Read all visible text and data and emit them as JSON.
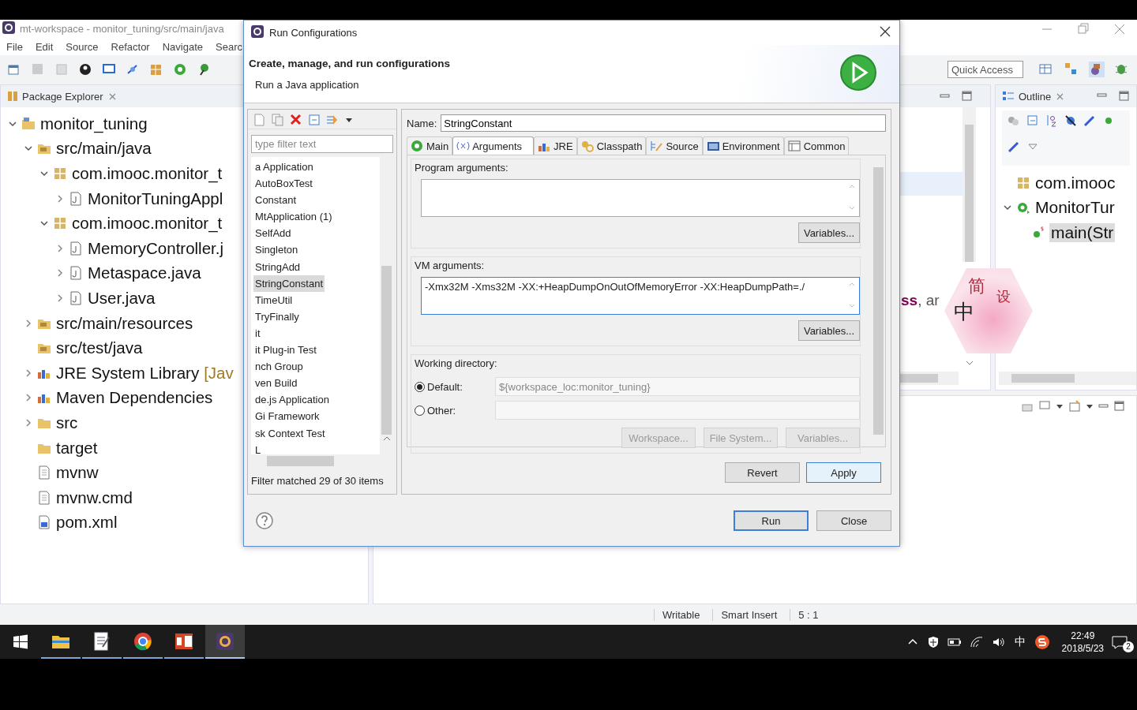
{
  "window": {
    "title": "mt-workspace - monitor_tuning/src/main/java"
  },
  "menu": [
    "File",
    "Edit",
    "Source",
    "Refactor",
    "Navigate",
    "Searc"
  ],
  "quick_access": {
    "placeholder": "Quick Access"
  },
  "package_explorer": {
    "title": "Package Explorer",
    "tree": [
      {
        "label": "monitor_tuning",
        "kind": "project",
        "expanded": true,
        "children": [
          {
            "label": "src/main/java",
            "kind": "source-folder",
            "expanded": true,
            "children": [
              {
                "label": "com.imooc.monitor_t",
                "kind": "package",
                "expanded": true,
                "children": [
                  {
                    "label": "MonitorTuningAppl",
                    "kind": "java-file",
                    "expanded": false
                  }
                ]
              },
              {
                "label": "com.imooc.monitor_t",
                "kind": "package",
                "expanded": true,
                "children": [
                  {
                    "label": "MemoryController.j",
                    "kind": "java-file",
                    "expanded": false
                  },
                  {
                    "label": "Metaspace.java",
                    "kind": "java-file",
                    "expanded": false
                  },
                  {
                    "label": "User.java",
                    "kind": "java-file",
                    "expanded": false
                  }
                ]
              }
            ]
          },
          {
            "label": "src/main/resources",
            "kind": "source-folder",
            "expanded": false
          },
          {
            "label": "src/test/java",
            "kind": "source-folder"
          },
          {
            "label": "JRE System Library",
            "suffix": "[Jav",
            "kind": "library",
            "expanded": false
          },
          {
            "label": "Maven Dependencies",
            "kind": "library",
            "expanded": false
          },
          {
            "label": "src",
            "kind": "folder",
            "expanded": false
          },
          {
            "label": "target",
            "kind": "folder"
          },
          {
            "label": "mvnw",
            "kind": "file"
          },
          {
            "label": "mvnw.cmd",
            "kind": "file"
          },
          {
            "label": "pom.xml",
            "kind": "xml-file"
          }
        ]
      }
    ]
  },
  "editor": {
    "code_fragment": "**ss**, ar"
  },
  "outline": {
    "title": "Outline",
    "tree": [
      {
        "label": "com.imooc",
        "kind": "package",
        "selected": false
      },
      {
        "label": "MonitorTur",
        "kind": "class",
        "selected": false,
        "expanded": true,
        "children": [
          {
            "label": "main(Str",
            "kind": "method",
            "selected": true
          }
        ]
      }
    ]
  },
  "dialog": {
    "title": "Run Configurations",
    "heading": "Create, manage, and run configurations",
    "subheading": "Run a Java application",
    "filter": {
      "placeholder": "type filter text"
    },
    "configurations": [
      {
        "label": "a Application",
        "selected": false
      },
      {
        "label": "AutoBoxTest",
        "selected": false
      },
      {
        "label": "Constant",
        "selected": false
      },
      {
        "label": "MtApplication (1)",
        "selected": false
      },
      {
        "label": "SelfAdd",
        "selected": false
      },
      {
        "label": "Singleton",
        "selected": false
      },
      {
        "label": "StringAdd",
        "selected": false
      },
      {
        "label": "StringConstant",
        "selected": true
      },
      {
        "label": "TimeUtil",
        "selected": false
      },
      {
        "label": "TryFinally",
        "selected": false
      },
      {
        "label": "it",
        "selected": false
      },
      {
        "label": "it Plug-in Test",
        "selected": false
      },
      {
        "label": "nch Group",
        "selected": false
      },
      {
        "label": "ven Build",
        "selected": false
      },
      {
        "label": "de.js Application",
        "selected": false
      },
      {
        "label": "Gi Framework",
        "selected": false
      },
      {
        "label": "sk Context Test",
        "selected": false
      },
      {
        "label": "L",
        "selected": false
      }
    ],
    "filter_status": "Filter matched 29 of 30 items",
    "name": {
      "label": "Name:",
      "value": "StringConstant"
    },
    "tabs": [
      {
        "label": "Main",
        "kind": "main",
        "selected": false
      },
      {
        "label": "Arguments",
        "kind": "arguments",
        "selected": true
      },
      {
        "label": "JRE",
        "kind": "jre",
        "selected": false
      },
      {
        "label": "Classpath",
        "kind": "classpath",
        "selected": false
      },
      {
        "label": "Source",
        "kind": "source",
        "selected": false
      },
      {
        "label": "Environment",
        "kind": "environment",
        "selected": false
      },
      {
        "label": "Common",
        "kind": "common",
        "selected": false
      }
    ],
    "program_arguments": {
      "label": "Program arguments:",
      "focused": false,
      "button": "Variables..."
    },
    "vm_arguments": {
      "label": "VM arguments:",
      "value": "-Xmx32M -Xms32M -XX:+HeapDumpOnOutOfMemoryError  -XX:HeapDumpPath=./",
      "focused": true,
      "button": "Variables..."
    },
    "working_directory": {
      "label": "Working directory:",
      "options": [
        {
          "label": "Default:",
          "selected": true,
          "value": "${workspace_loc:monitor_tuning}"
        },
        {
          "label": "Other:",
          "selected": false
        }
      ],
      "buttons": [
        {
          "label": "Workspace...",
          "disabled": true
        },
        {
          "label": "File System...",
          "disabled": true
        },
        {
          "label": "Variables...",
          "disabled": true
        }
      ]
    },
    "actions": [
      {
        "label": "Revert",
        "hovered": false
      },
      {
        "label": "Apply",
        "hovered": true
      }
    ],
    "footer_buttons": [
      {
        "label": "Run",
        "default": true
      },
      {
        "label": "Close",
        "default": false
      }
    ]
  },
  "status_bar": [
    "Writable",
    "Smart Insert",
    "5 : 1"
  ],
  "ime_widget": {
    "script": "简",
    "settings": "设",
    "mode": "中"
  },
  "taskbar": {
    "apps": [
      {
        "kind": "file-explorer",
        "active": false
      },
      {
        "kind": "notepad",
        "active": false
      },
      {
        "kind": "browser",
        "active": false
      },
      {
        "kind": "presentation",
        "active": false
      },
      {
        "kind": "eclipse",
        "active": true
      }
    ],
    "tray": {
      "language": "中",
      "time": "22:49",
      "date": "2018/5/23",
      "notifications": "2"
    }
  }
}
